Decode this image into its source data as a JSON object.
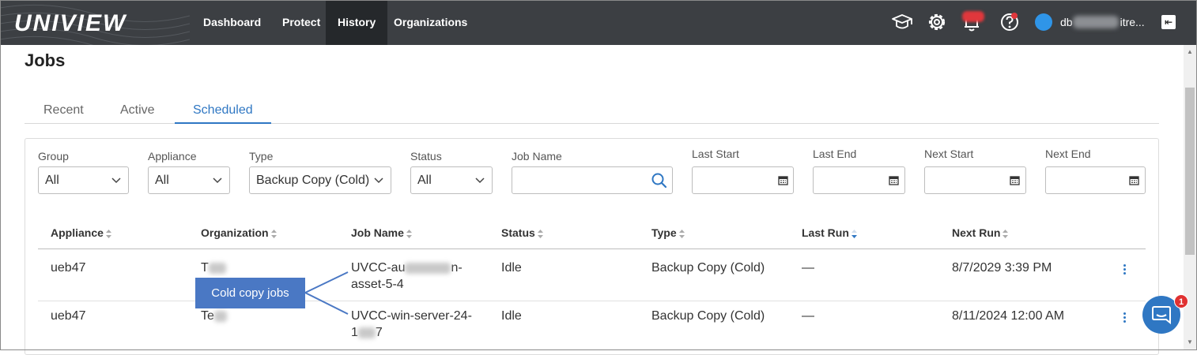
{
  "app": {
    "logo": "UNIVIEW"
  },
  "nav": [
    {
      "label": "Dashboard",
      "active": false
    },
    {
      "label": "Protect",
      "active": false
    },
    {
      "label": "History",
      "active": true
    },
    {
      "label": "Organizations",
      "active": false
    }
  ],
  "header_icons": [
    "graduation-cap-icon",
    "gear-icon",
    "bell-icon",
    "help-icon"
  ],
  "user": {
    "name_start": "db",
    "name_end": "itre..."
  },
  "page": {
    "title": "Jobs"
  },
  "tabs": [
    {
      "label": "Recent",
      "active": false
    },
    {
      "label": "Active",
      "active": false
    },
    {
      "label": "Scheduled",
      "active": true
    }
  ],
  "filters": {
    "group": {
      "label": "Group",
      "value": "All"
    },
    "appliance": {
      "label": "Appliance",
      "value": "All"
    },
    "type": {
      "label": "Type",
      "value": "Backup Copy (Cold)"
    },
    "status": {
      "label": "Status",
      "value": "All"
    },
    "job_name": {
      "label": "Job Name",
      "value": ""
    },
    "last_start": {
      "label": "Last Start",
      "value": ""
    },
    "last_end": {
      "label": "Last End",
      "value": ""
    },
    "next_start": {
      "label": "Next Start",
      "value": ""
    },
    "next_end": {
      "label": "Next End",
      "value": ""
    }
  },
  "table": {
    "columns": [
      "Appliance",
      "Organization",
      "Job Name",
      "Status",
      "Type",
      "Last Run",
      "Next Run"
    ],
    "sorted_column": "Last Run",
    "rows": [
      {
        "appliance": "ueb47",
        "organization": "T",
        "job_name_1": "UVCC-au",
        "job_name_1b": "n-",
        "job_name_2": "asset-5-4",
        "status": "Idle",
        "type": "Backup Copy (Cold)",
        "last_run": "—",
        "next_run": "8/7/2029 3:39 PM"
      },
      {
        "appliance": "ueb47",
        "organization": "Te",
        "job_name_1": "UVCC-win-server-24-",
        "job_name_2a": "1",
        "job_name_2": "7",
        "status": "Idle",
        "type": "Backup Copy (Cold)",
        "last_run": "—",
        "next_run": "8/11/2024 12:00 AM"
      }
    ]
  },
  "annotation": {
    "text": "Cold copy jobs"
  },
  "chat": {
    "badge": "1"
  },
  "colors": {
    "topbar": "#3c3f43",
    "accent": "#2f77c3",
    "callout": "#4a78c4",
    "alert": "#e0373c"
  }
}
